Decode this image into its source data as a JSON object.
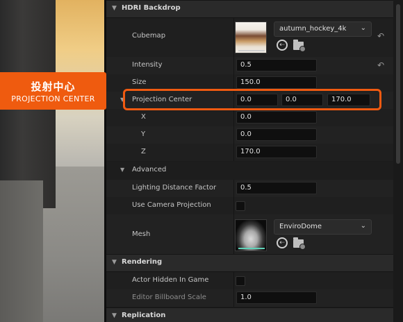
{
  "callout": {
    "chinese": "投射中心",
    "english": "PROJECTION CENTER"
  },
  "sections": {
    "hdri_backdrop": "HDRI Backdrop",
    "advanced": "Advanced",
    "rendering": "Rendering",
    "replication": "Replication"
  },
  "cubemap": {
    "label": "Cubemap",
    "asset": "autumn_hockey_4k"
  },
  "intensity": {
    "label": "Intensity",
    "value": "0.5"
  },
  "size": {
    "label": "Size",
    "value": "150.0"
  },
  "projection_center": {
    "label": "Projection Center",
    "x": "0.0",
    "y": "0.0",
    "z": "170.0",
    "x_label": "X",
    "y_label": "Y",
    "z_label": "Z",
    "x_value": "0.0",
    "y_value": "0.0",
    "z_value": "170.0"
  },
  "lighting_distance_factor": {
    "label": "Lighting Distance Factor",
    "value": "0.5"
  },
  "use_camera_projection": {
    "label": "Use Camera Projection",
    "checked": false
  },
  "mesh": {
    "label": "Mesh",
    "asset": "EnviroDome"
  },
  "actor_hidden_in_game": {
    "label": "Actor Hidden In Game",
    "checked": false
  },
  "editor_billboard_scale": {
    "label": "Editor Billboard Scale",
    "value": "1.0"
  },
  "icons": {
    "chevron": "chevron-down-icon",
    "reset": "reset-arrow-icon",
    "use_selected": "arrow-left-circle-icon",
    "browse": "folder-search-icon"
  },
  "colors": {
    "accent": "#ef5b0f",
    "panel": "#1c1c1c",
    "field": "#0f0f0f"
  }
}
